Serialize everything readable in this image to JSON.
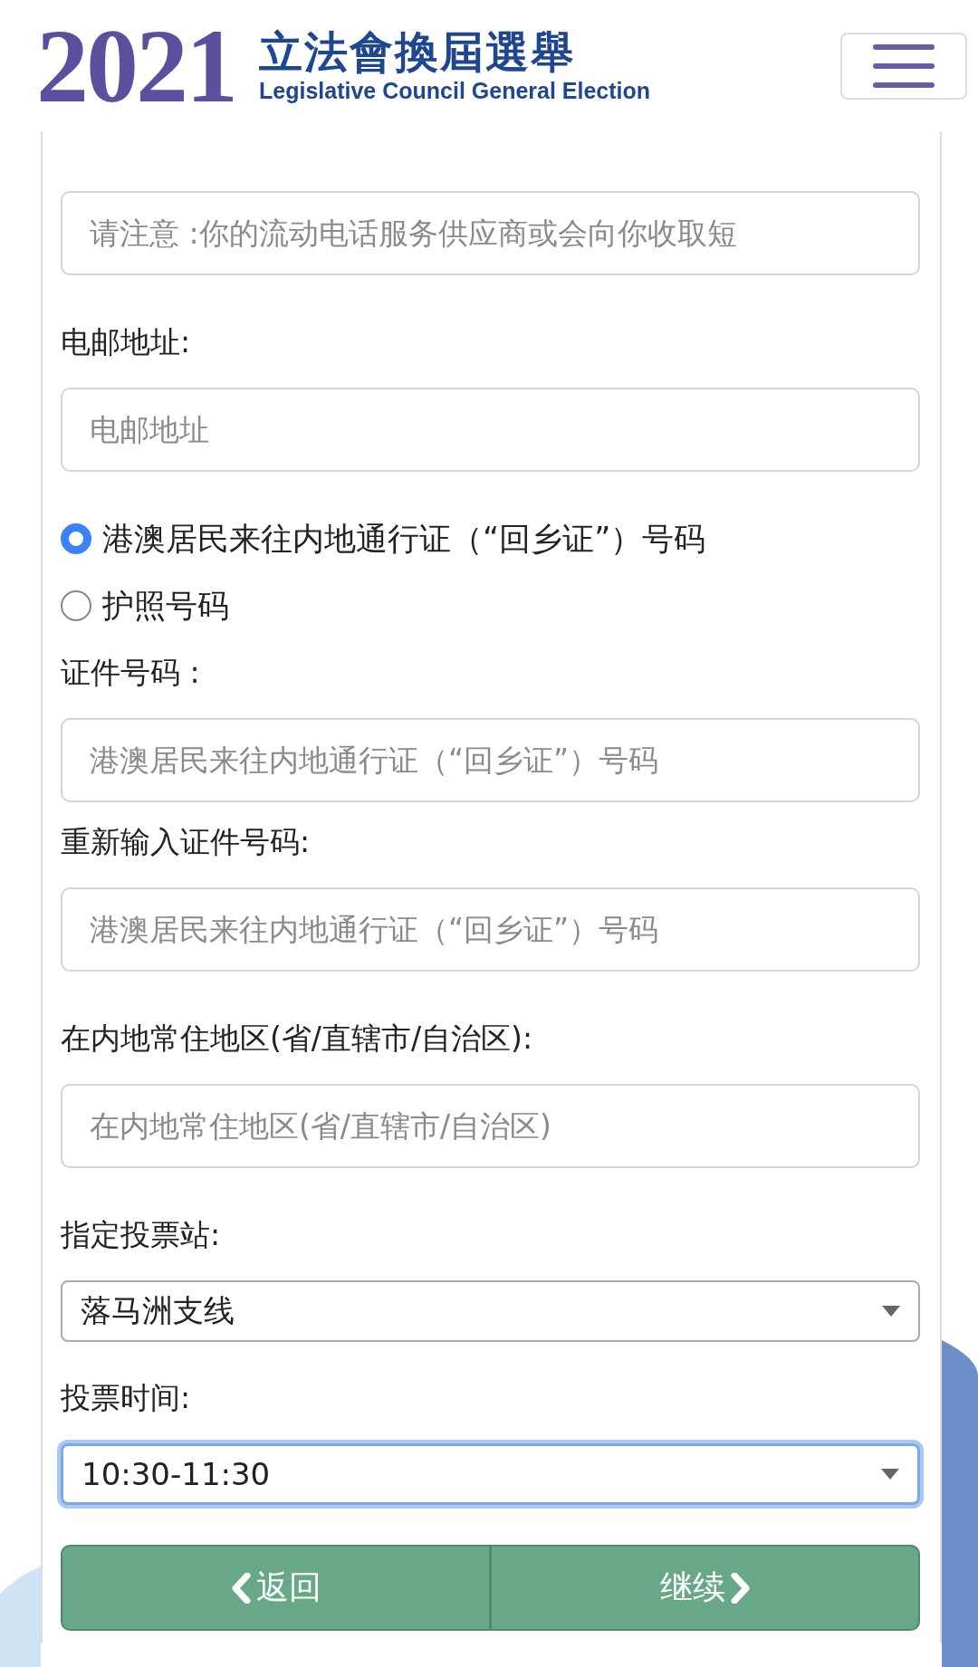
{
  "header": {
    "year": "2021",
    "title": "立法會換屆選舉",
    "subtitle": "Legislative Council General Election"
  },
  "form": [
    {
      "kind": "field",
      "placeholder": "请注意 :你的流动电话服务供应商或会向你收取短"
    },
    {
      "kind": "field",
      "label": "电邮地址:",
      "placeholder": "电邮地址"
    },
    {
      "kind": "radio",
      "label": "港澳居民来往内地通行证（“回乡证”）号码",
      "selected": true
    },
    {
      "kind": "radio",
      "label": "护照号码",
      "selected": false
    },
    {
      "kind": "field",
      "label": "证件号码 :",
      "placeholder": "港澳居民来往内地通行证（“回乡证”）号码"
    },
    {
      "kind": "field",
      "label": "重新输入证件号码:",
      "placeholder": "港澳居民来往内地通行证（“回乡证”）号码"
    },
    {
      "kind": "field",
      "label": "在内地常住地区(省/直辖市/自治区):",
      "placeholder": "在内地常住地区(省/直辖市/自治区)"
    },
    {
      "kind": "select",
      "label": "指定投票站:",
      "value": "落马洲支线",
      "focused": false
    },
    {
      "kind": "select",
      "label": "投票时间:",
      "value": "10:30-11:30",
      "focused": true
    }
  ],
  "buttons": [
    {
      "kind": "back",
      "label": "返回"
    },
    {
      "kind": "next",
      "label": "继续"
    }
  ]
}
